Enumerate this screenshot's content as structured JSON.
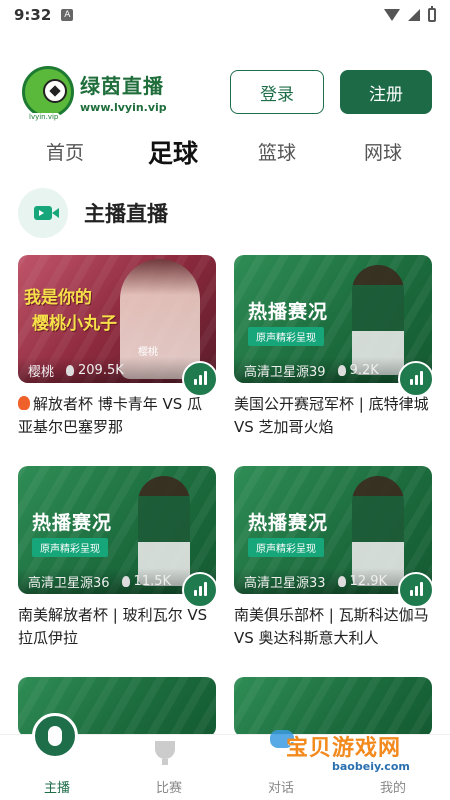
{
  "status_bar": {
    "time": "9:32",
    "notification_icon": "A"
  },
  "header": {
    "logo_title": "绿茵直播",
    "logo_url": "www.lvyin.vip",
    "logo_small_url": "lvyin.vip",
    "login_label": "登录",
    "register_label": "注册"
  },
  "tabs": [
    {
      "label": "首页"
    },
    {
      "label": "足球"
    },
    {
      "label": "篮球"
    },
    {
      "label": "网球"
    }
  ],
  "active_tab": "足球",
  "section": {
    "title": "主播直播",
    "icon": "video-camera-icon"
  },
  "cards": [
    {
      "title": "解放者杯 博卡青年 VS 瓜亚基尔巴塞罗那",
      "source": "樱桃",
      "views": "209.5K",
      "promo": "我是你的樱桃小丸子",
      "promo_line1": "我是你的",
      "promo_line2": "樱桃小丸子",
      "promo_tag": "樱桃",
      "has_fire": true
    },
    {
      "title": "美国公开赛冠军杯 | 底特律城 VS 芝加哥火焰",
      "source": "高清卫星源39",
      "views": "9.2K",
      "promo": "热播赛况",
      "promo_sub": "原声精彩呈现"
    },
    {
      "title": "南美解放者杯 | 玻利瓦尔 VS 拉瓜伊拉",
      "source": "高清卫星源36",
      "views": "11.5K",
      "promo": "热播赛况",
      "promo_sub": "原声精彩呈现"
    },
    {
      "title": "南美俱乐部杯 | 瓦斯科达伽马 VS 奥达科斯意大利人",
      "source": "高清卫星源33",
      "views": "12.9K",
      "promo": "热播赛况",
      "promo_sub": "原声精彩呈现"
    }
  ],
  "bottom_nav": [
    {
      "label": "主播",
      "icon": "microphone-icon"
    },
    {
      "label": "比赛",
      "icon": "trophy-icon"
    },
    {
      "label": "对话",
      "icon": "chat-icon"
    },
    {
      "label": "我的",
      "icon": "user-icon"
    }
  ],
  "watermark": {
    "text": "宝贝游戏网",
    "url": "baobeiy.com"
  },
  "colors": {
    "brand": "#1c6a46",
    "accent": "#17a57a"
  }
}
